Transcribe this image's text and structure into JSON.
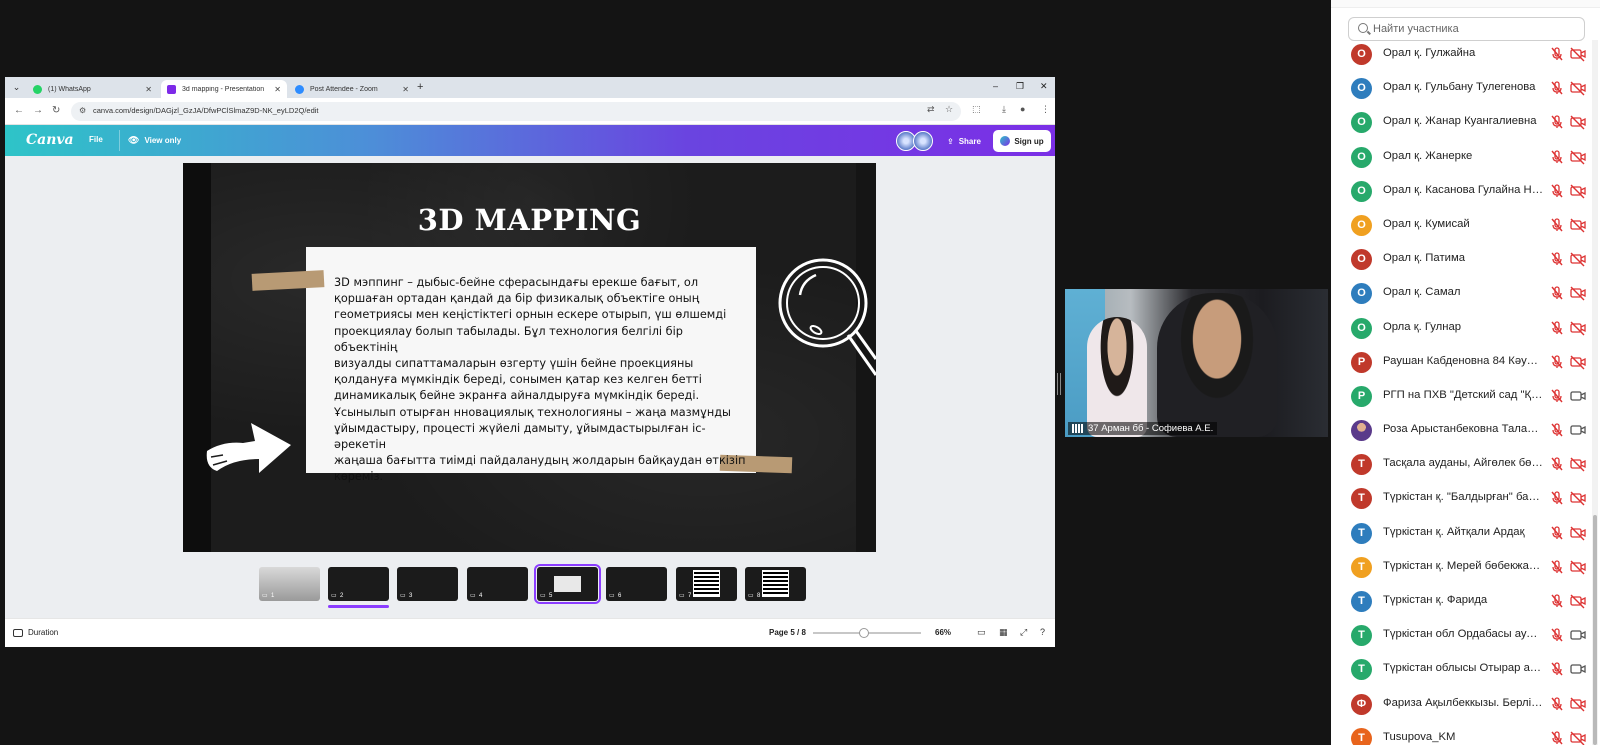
{
  "browser": {
    "tabs": [
      {
        "label": "(1) WhatsApp",
        "color": "#25d366",
        "active": false
      },
      {
        "label": "3d mapping - Presentation",
        "color": "#7d2ae8",
        "active": true
      },
      {
        "label": "Post Attendee - Zoom",
        "color": "#2d8cff",
        "active": false
      }
    ],
    "new_tab": "+",
    "url": "canva.com/design/DAGjzl_GzJA/DfwPClSlmaZ9D-NK_eyLD2Q/edit",
    "window_controls": {
      "minimize": "–",
      "restore": "❐",
      "close": "✕"
    }
  },
  "canva": {
    "logo": "Canva",
    "menu_file": "File",
    "view_only": "View only",
    "share": "Share",
    "sign_up": "Sign up",
    "slide": {
      "title": "3D MAPPING",
      "body": " 3D мэппинг – дыбыс-бейне сферасындағы ерекше бағыт, ол\nқоршаған ортадан қандай да бір физикалық объектіге оның\nгеометриясы мен кеңістіктегі орнын ескере отырып, үш өлшемді\nпроекциялау болып табылады. Бұл технология белгілі бір объектінің\nвизуалды сипаттамаларын өзгерту үшін бейне проекцияны\nқолдануға мүмкіндік береді, сонымен қатар кез келген бетті\nдинамикалық бейне экранға айналдыруға мүмкіндік береді.\nҰсынылып отырған нновациялық технологияны – жаңа мазмұнды\nұйымдастыру, процесті жүйелі дамыту, ұйымдастырылған іс-әрекетін\nжаңаша бағытта тиімді пайдаланудың жолдарын байқаудан өткізіп\nкөреміз."
    },
    "thumbnails": [
      {
        "num": "1",
        "style": "light"
      },
      {
        "num": "2",
        "style": "dark"
      },
      {
        "num": "3",
        "style": "dark"
      },
      {
        "num": "4",
        "style": "dark"
      },
      {
        "num": "5",
        "style": "card"
      },
      {
        "num": "6",
        "style": "dark"
      },
      {
        "num": "7",
        "style": "qr"
      },
      {
        "num": "8",
        "style": "qr"
      }
    ],
    "active_thumbnail": 5,
    "footer": {
      "duration": "Duration",
      "page": "Page 5 / 8",
      "zoom_percent": 66,
      "zoom": "66%"
    }
  },
  "video": {
    "name_label": "37 Арман бб - Софиева А.Е."
  },
  "participants": {
    "search_placeholder": "Найти участника",
    "items": [
      {
        "initial": "О",
        "name": "Орал қ. Гулжайна",
        "color": "#c0392b",
        "camera": "off"
      },
      {
        "initial": "О",
        "name": "Орал қ. Гульбану Тулегенова",
        "color": "#2e7dbd",
        "camera": "off"
      },
      {
        "initial": "О",
        "name": "Орал қ. Жанар Куангалиевна",
        "color": "#27a96b",
        "camera": "off"
      },
      {
        "initial": "О",
        "name": "Орал қ. Жанерке",
        "color": "#27a96b",
        "camera": "off"
      },
      {
        "initial": "О",
        "name": "Орал қ. Касанова Гулайна На...",
        "color": "#27a96b",
        "camera": "off"
      },
      {
        "initial": "О",
        "name": "Орал қ. Кумисай",
        "color": "#f0a020",
        "camera": "off"
      },
      {
        "initial": "О",
        "name": "Орал қ. Патима",
        "color": "#c0392b",
        "camera": "off"
      },
      {
        "initial": "О",
        "name": "Орал қ. Самал",
        "color": "#2e7dbd",
        "camera": "off"
      },
      {
        "initial": "О",
        "name": "Орла қ. Гулнар",
        "color": "#27a96b",
        "camera": "off"
      },
      {
        "initial": "Р",
        "name": "Раушан Кабденовна 84 Кәуса...",
        "color": "#c0392b",
        "camera": "off"
      },
      {
        "initial": "Р",
        "name": "РГП на ПХВ \"Детский сад \"Қар...",
        "color": "#27a96b",
        "camera": "on"
      },
      {
        "initial": "",
        "name": "Роза Арыстанбековна Таласо...",
        "color": "#6a4cc4",
        "camera": "on",
        "photo": true
      },
      {
        "initial": "Т",
        "name": "Тасқала ауданы, Айгөлек бөб...",
        "color": "#c0392b",
        "camera": "off"
      },
      {
        "initial": "Т",
        "name": "Түркістан қ. \"Балдырған\" бала...",
        "color": "#c0392b",
        "camera": "off"
      },
      {
        "initial": "Т",
        "name": "Түркістан қ. Айтқали Ардақ",
        "color": "#2e7dbd",
        "camera": "off"
      },
      {
        "initial": "Т",
        "name": "Түркістан қ. Мерей бөбекжайы",
        "color": "#f0a020",
        "camera": "off"
      },
      {
        "initial": "Т",
        "name": "Түркістан қ. Фарида",
        "color": "#2e7dbd",
        "camera": "off"
      },
      {
        "initial": "Т",
        "name": "Түркістан обл Ордабасы ауда...",
        "color": "#27a96b",
        "camera": "on"
      },
      {
        "initial": "Т",
        "name": "Түркістан облысы Отырар ауд...",
        "color": "#27a96b",
        "camera": "on"
      },
      {
        "initial": "Ф",
        "name": "Фариза Ақылбеккызы. Берлі. ...",
        "color": "#c0392b",
        "camera": "off"
      },
      {
        "initial": "T",
        "name": "Tusupova_KM",
        "color": "#e8641c",
        "camera": "off"
      }
    ]
  }
}
